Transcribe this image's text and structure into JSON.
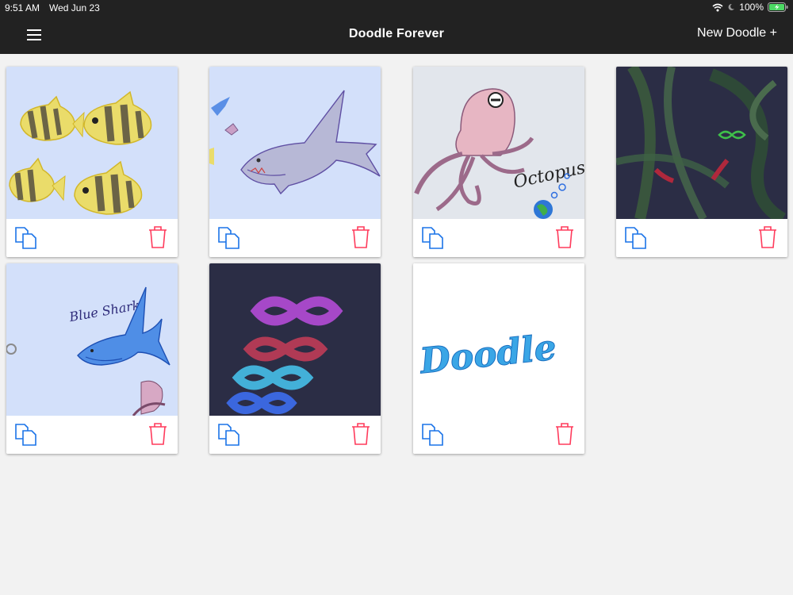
{
  "status_bar": {
    "time": "9:51 AM",
    "date": "Wed Jun 23",
    "battery": "100%",
    "icons": [
      "wifi-icon",
      "moon-icon",
      "battery-charging-icon"
    ]
  },
  "header": {
    "title": "Doodle Forever",
    "new_button_label": "New Doodle +",
    "menu_icon": "hamburger-menu-icon"
  },
  "colors": {
    "header_bg": "#222222",
    "page_bg": "#f2f2f2",
    "copy_icon": "#1a73e8",
    "trash_icon": "#ff3b5c"
  },
  "doodles": [
    {
      "thumbnail": "yellow-striped-fish",
      "bg": "#d3e0fa"
    },
    {
      "thumbnail": "shark",
      "bg": "#d3e0fa"
    },
    {
      "thumbnail": "octopus",
      "bg": "#e2e6ec",
      "drawn_text": "Octopus"
    },
    {
      "thumbnail": "dark-green-swirls",
      "bg": "#2b2d45"
    },
    {
      "thumbnail": "blue-shark",
      "bg": "#d3e0fa",
      "drawn_text": "Blue Shark"
    },
    {
      "thumbnail": "infinity-loops",
      "bg": "#2b2d45"
    },
    {
      "thumbnail": "doodle-lettering",
      "bg": "#ffffff",
      "drawn_text": "Doodle"
    }
  ]
}
